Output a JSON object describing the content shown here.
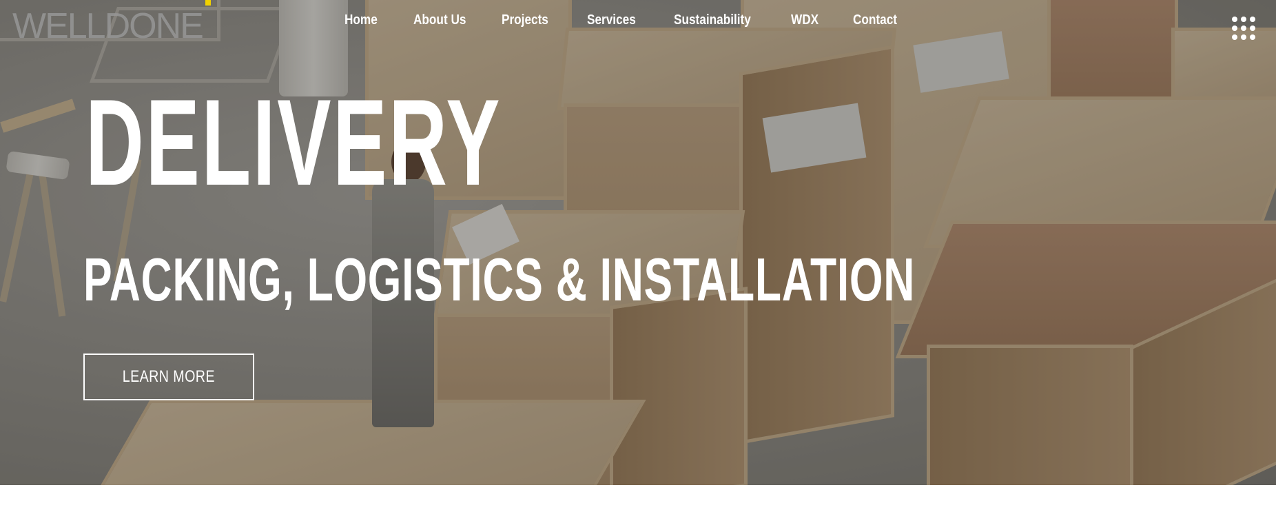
{
  "brand": {
    "logo_text": "WELLDONE",
    "accent_color": "#f1d100"
  },
  "nav": {
    "items": [
      {
        "label": "Home"
      },
      {
        "label": "About Us"
      },
      {
        "label": "Projects"
      },
      {
        "label": "Services"
      },
      {
        "label": "Sustainability"
      },
      {
        "label": "WDX"
      },
      {
        "label": "Contact"
      }
    ],
    "menu_icon": "grid-menu-icon"
  },
  "hero": {
    "title": "DELIVERY",
    "subtitle": "PACKING, LOGISTICS & INSTALLATION",
    "cta_label": "LEARN MORE",
    "background": "warehouse-crates-photo"
  },
  "colors": {
    "text": "#ffffff",
    "page_background": "#ffffff"
  }
}
